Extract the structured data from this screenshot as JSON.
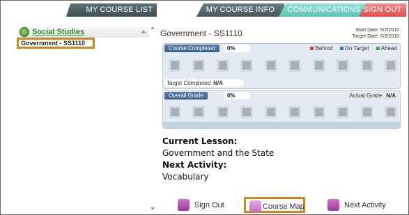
{
  "tabs": {
    "course_list": "MY COURSE LIST",
    "course_info": "MY COURSE INFO",
    "communications": "COMMUNICATIONS",
    "sign_out": "SIGN OUT"
  },
  "sidebar": {
    "subject": "Social Studies",
    "course": "Government - SS1110"
  },
  "main": {
    "course_title": "Government - SS1110",
    "start_date": "Start Date: 6/2/2010",
    "target_date": "Target Date: 6/2/2010",
    "completed": {
      "label": "Course Completed",
      "value": "0%",
      "legend": {
        "behind": "Behind",
        "on_target": "On Target",
        "ahead": "Ahead"
      },
      "target_label": "Target Completed",
      "target_value": "N/A"
    },
    "grade": {
      "label": "Overall Grade",
      "value": "0%",
      "actual_label": "Actual Grade",
      "actual_value": "N/A"
    },
    "current_lesson_heading": "Current Lesson:",
    "current_lesson": "Government and the State",
    "next_activity_heading": "Next Activity:",
    "next_activity": "Vocabulary"
  },
  "buttons": {
    "sign_out": "Sign Out",
    "course_map": "Course Map",
    "next_activity": "Next Activity"
  },
  "colors": {
    "behind": "#e03a3a",
    "on_target": "#3a6ee0",
    "ahead": "#3ab43a",
    "highlight": "#d0861c"
  }
}
